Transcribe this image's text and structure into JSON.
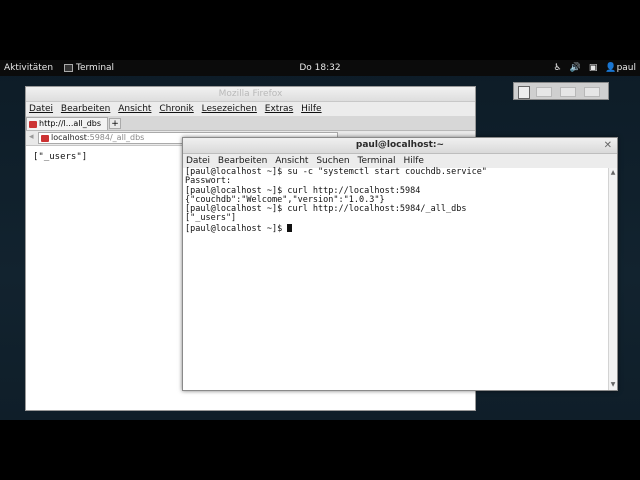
{
  "topbar": {
    "activities": "Aktivitäten",
    "app_name": "Terminal",
    "clock": "Do 18:32",
    "user": "paul"
  },
  "firefox": {
    "title": "Mozilla Firefox",
    "menu": [
      "Datei",
      "Bearbeiten",
      "Ansicht",
      "Chronik",
      "Lesezeichen",
      "Extras",
      "Hilfe"
    ],
    "tab_label": "http://l...all_dbs",
    "new_tab": "+",
    "url_host": "localhost",
    "url_path": ":5984/_all_dbs",
    "content": "[\"_users\"]"
  },
  "terminal": {
    "title": "paul@localhost:~",
    "menu": [
      "Datei",
      "Bearbeiten",
      "Ansicht",
      "Suchen",
      "Terminal",
      "Hilfe"
    ],
    "lines": [
      "[paul@localhost ~]$ su -c \"systemctl start couchdb.service\"",
      "Passwort:",
      "[paul@localhost ~]$ curl http://localhost:5984",
      "{\"couchdb\":\"Welcome\",\"version\":\"1.0.3\"}",
      "[paul@localhost ~]$ curl http://localhost:5984/_all_dbs",
      "[\"_users\"]",
      "[paul@localhost ~]$ "
    ]
  }
}
